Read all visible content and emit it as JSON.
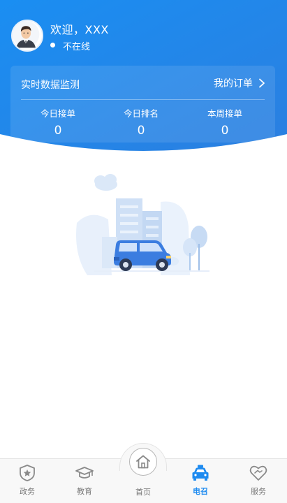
{
  "header": {
    "welcome_text": "欢迎，XXX",
    "status_text": "不在线",
    "gradient_start": "#1a8ef2",
    "gradient_end": "#2b7fe0"
  },
  "monitor_card": {
    "title": "实时数据监测",
    "orders_link_label": "我的订单",
    "stats": [
      {
        "label": "今日接单",
        "value": "0"
      },
      {
        "label": "今日排名",
        "value": "0"
      },
      {
        "label": "本周接单",
        "value": "0"
      }
    ]
  },
  "tabbar": {
    "active_color": "#1e8bf0",
    "inactive_color": "#777777",
    "tabs": [
      {
        "label": "政务",
        "icon": "shield-star-icon"
      },
      {
        "label": "教育",
        "icon": "graduation-cap-icon"
      },
      {
        "label": "首页",
        "icon": "home-icon"
      },
      {
        "label": "电召",
        "icon": "taxi-icon"
      },
      {
        "label": "服务",
        "icon": "heart-handshake-icon"
      }
    ]
  }
}
